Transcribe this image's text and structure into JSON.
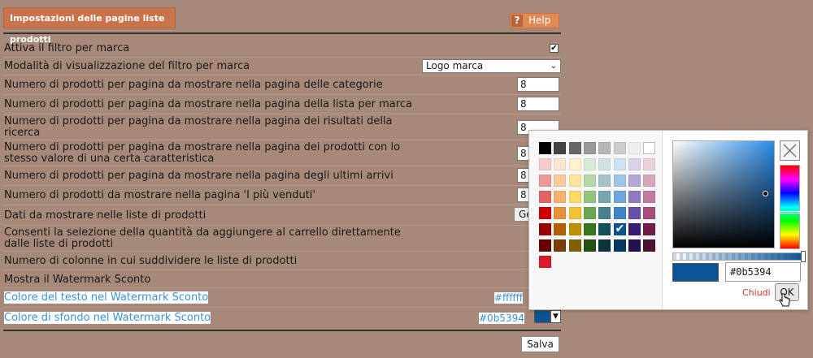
{
  "title": "Impostazioni delle pagine liste prodotti",
  "help_label": "Help",
  "help_icon": "?",
  "rows": [
    {
      "label": "Attiva il filtro per marca"
    },
    {
      "label": "Modalità di visualizzazione del filtro per marca",
      "select_value": "Logo marca"
    },
    {
      "label": "Numero di prodotti per pagina da mostrare nella pagina delle categorie",
      "value": "8"
    },
    {
      "label": "Numero di prodotti per pagina da mostrare nella pagina della lista per marca",
      "value": "8"
    },
    {
      "label": "Numero di prodotti per pagina da mostrare nella pagina dei risultati della ricerca",
      "value": "8"
    },
    {
      "label": "Numero di prodotti per pagina da mostrare nella pagina dei prodotti con lo stesso valore di una certa caratteristica",
      "value": "8"
    },
    {
      "label": "Numero di prodotti per pagina da mostrare nella pagina degli ultimi arrivi",
      "value": "8"
    },
    {
      "label": "Numero di prodotti da mostrare nella pagina 'I più venduti'",
      "value": "8"
    },
    {
      "label": "Dati da mostrare nelle liste di prodotti",
      "button": "Ge"
    },
    {
      "label": "Consenti la selezione della quantità da aggiungere al carrello direttamente dalle liste di prodotti"
    },
    {
      "label": "Numero di colonne in cui suddividere le liste di prodotti"
    },
    {
      "label": "Mostra il Watermark Sconto"
    },
    {
      "label": "Colore del testo nel Watermark Sconto",
      "hex": "#ffffff"
    },
    {
      "label": "Colore di sfondo nel Watermark Sconto",
      "hex": "#0b5394"
    }
  ],
  "save_label": "Salva",
  "color_picker": {
    "hex_value": "#0b5394",
    "selected_color": "#0b5394",
    "close_label": "Chiudi",
    "ok_label": "OK",
    "palette": [
      [
        "#000000",
        "#434343",
        "#666666",
        "#999999",
        "#b7b7b7",
        "#cccccc",
        "#efefef",
        "#ffffff"
      ],
      [
        "#f4cccc",
        "#fce5cd",
        "#fff2cc",
        "#d9ead3",
        "#d0e0e3",
        "#cfe2f3",
        "#d9d2e9",
        "#ead1dc"
      ],
      [
        "#ea9999",
        "#f9cb9c",
        "#ffe599",
        "#b6d7a8",
        "#a2c4c9",
        "#9fc5e8",
        "#b4a7d6",
        "#d5a6bd"
      ],
      [
        "#e06666",
        "#f6b26b",
        "#ffd966",
        "#93c47d",
        "#76a5af",
        "#6fa8dc",
        "#8e7cc3",
        "#c27ba0"
      ],
      [
        "#cc0000",
        "#e69138",
        "#f1c232",
        "#6aa84f",
        "#45818e",
        "#3d85c6",
        "#674ea7",
        "#a64d79"
      ],
      [
        "#990000",
        "#b45f06",
        "#bf9000",
        "#38761d",
        "#134f5c",
        "#0b5394",
        "#351c75",
        "#741b47"
      ],
      [
        "#660000",
        "#783f04",
        "#7f6000",
        "#274e13",
        "#0c343d",
        "#073763",
        "#20124d",
        "#4c1130"
      ],
      [
        "#d91a2a"
      ]
    ]
  }
}
